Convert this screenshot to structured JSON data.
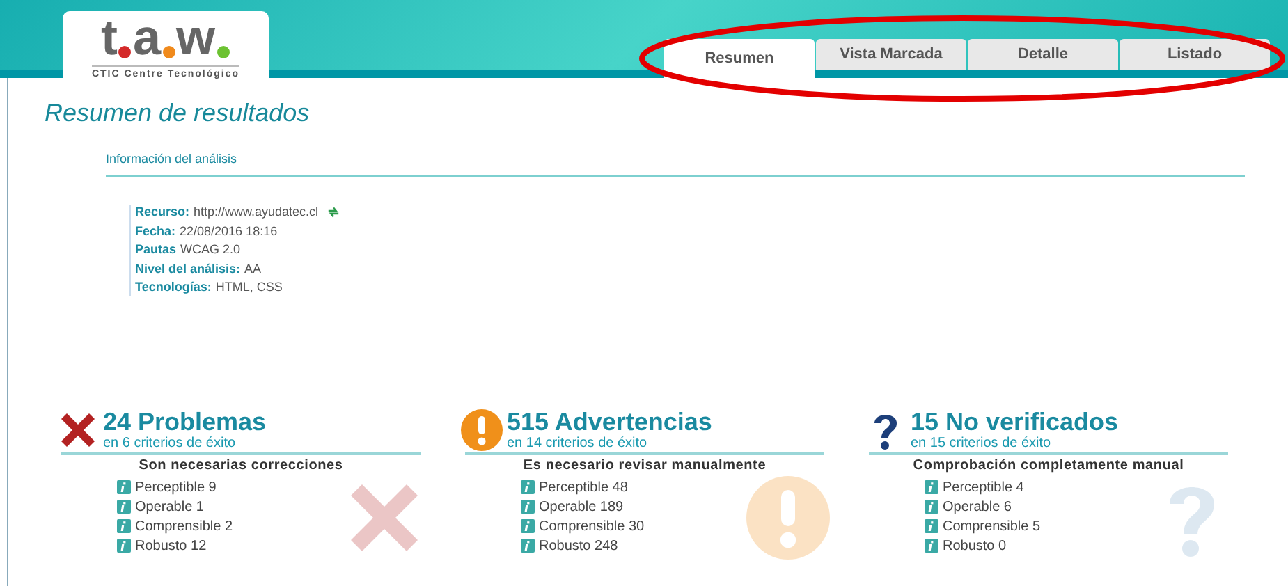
{
  "logo": {
    "letters": [
      {
        "text": "t",
        "color": "#d42a2a"
      },
      {
        "text": "a",
        "color": "#f08a1c"
      },
      {
        "text": "w",
        "color": "#6cc231"
      }
    ],
    "subtitle": "CTIC Centre Tecnológico"
  },
  "tabs": [
    {
      "label": "Resumen",
      "selected": true
    },
    {
      "label": "Vista Marcada",
      "selected": false
    },
    {
      "label": "Detalle",
      "selected": false
    },
    {
      "label": "Listado",
      "selected": false
    }
  ],
  "page_title": "Resumen de resultados",
  "info": {
    "heading": "Información del análisis",
    "fields": [
      {
        "label": "Recurso:",
        "value": "http://www.ayudatec.cl",
        "refresh": true
      },
      {
        "label": "Fecha:",
        "value": "22/08/2016 18:16",
        "refresh": false
      },
      {
        "label": "Pautas",
        "value": "WCAG 2.0",
        "refresh": false
      },
      {
        "label": "Nivel del análisis:",
        "value": "AA",
        "refresh": false
      },
      {
        "label": "Tecnologías:",
        "value": "HTML, CSS",
        "refresh": false
      }
    ]
  },
  "summaries": [
    {
      "kind": "error",
      "title": "24 Problemas",
      "subtitle": "en 6 criterios de éxito",
      "heading": "Son necesarias correcciones",
      "items": [
        "Perceptible 9",
        "Operable 1",
        "Comprensible 2",
        "Robusto 12"
      ]
    },
    {
      "kind": "warning",
      "title": "515 Advertencias",
      "subtitle": "en 14 criterios de éxito",
      "heading": "Es necesario revisar manualmente",
      "items": [
        "Perceptible 48",
        "Operable 189",
        "Comprensible 30",
        "Robusto 248"
      ]
    },
    {
      "kind": "unknown",
      "title": "15 No verificados",
      "subtitle": "en 15 criterios de éxito",
      "heading": "Comprobación completamente manual",
      "items": [
        "Perceptible 4",
        "Operable 6",
        "Comprensible 5",
        "Robusto 0"
      ]
    }
  ]
}
